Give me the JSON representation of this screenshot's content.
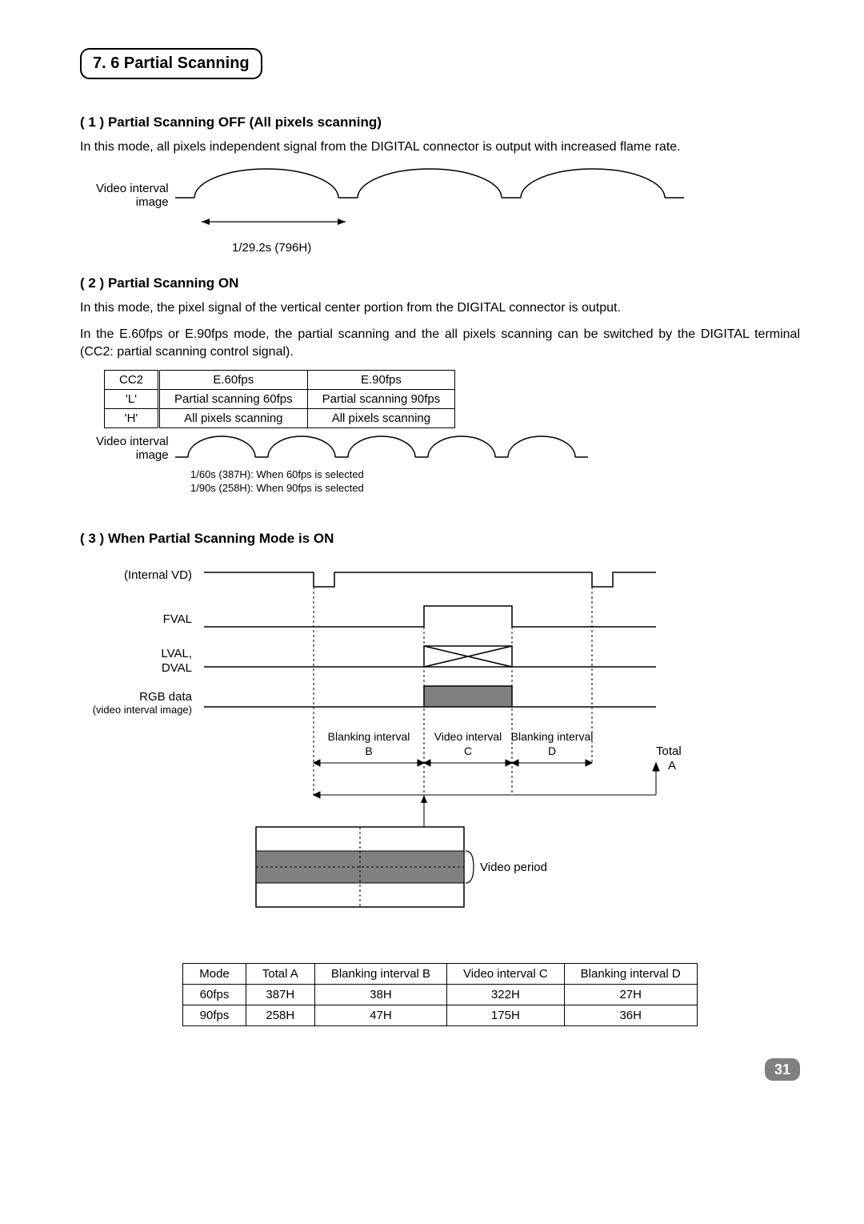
{
  "section_title": "7. 6  Partial Scanning",
  "sub1": {
    "heading": "( 1 )  Partial Scanning OFF (All pixels scanning)",
    "para": "In this mode, all pixels independent signal from the DIGITAL connector is output with increased flame rate.",
    "label_video_interval": "Video interval",
    "label_image": "image",
    "timing": "1/29.2s (796H)"
  },
  "sub2": {
    "heading": "( 2 )  Partial Scanning ON",
    "para1": "In this mode, the pixel signal of the vertical center portion from the DIGITAL connector is output.",
    "para2": "In the E.60fps or E.90fps mode, the partial scanning and the all pixels scanning can be switched by the DIGITAL terminal (CC2: partial scanning control signal).",
    "cc2_table": {
      "headers": [
        "CC2",
        "E.60fps",
        "E.90fps"
      ],
      "rows": [
        [
          "'L'",
          "Partial scanning 60fps",
          "Partial scanning 90fps"
        ],
        [
          "'H'",
          "All pixels scanning",
          "All pixels scanning"
        ]
      ]
    },
    "label_video_interval": "Video interval",
    "label_image": "image",
    "timing1": "1/60s (387H): When 60fps is selected",
    "timing2": "1/90s (258H): When 90fps is selected"
  },
  "sub3": {
    "heading": "( 3 )  When Partial Scanning Mode is ON",
    "labels": {
      "internal_vd": "(Internal VD)",
      "fval": "FVAL",
      "lval_dval": "LVAL,\nDVAL",
      "rgb": "RGB data",
      "video_sub": "(video interval image)",
      "blanking_b": "Blanking interval",
      "b": "B",
      "video_c": "Video interval",
      "c": "C",
      "blanking_d": "Blanking interval",
      "d": "D",
      "total": "Total",
      "a": "A",
      "video_period": "Video period"
    },
    "mode_table": {
      "headers": [
        "Mode",
        "Total A",
        "Blanking interval B",
        "Video interval C",
        "Blanking interval D"
      ],
      "rows": [
        [
          "60fps",
          "387H",
          "38H",
          "322H",
          "27H"
        ],
        [
          "90fps",
          "258H",
          "47H",
          "175H",
          "36H"
        ]
      ]
    }
  },
  "page_number": "31"
}
